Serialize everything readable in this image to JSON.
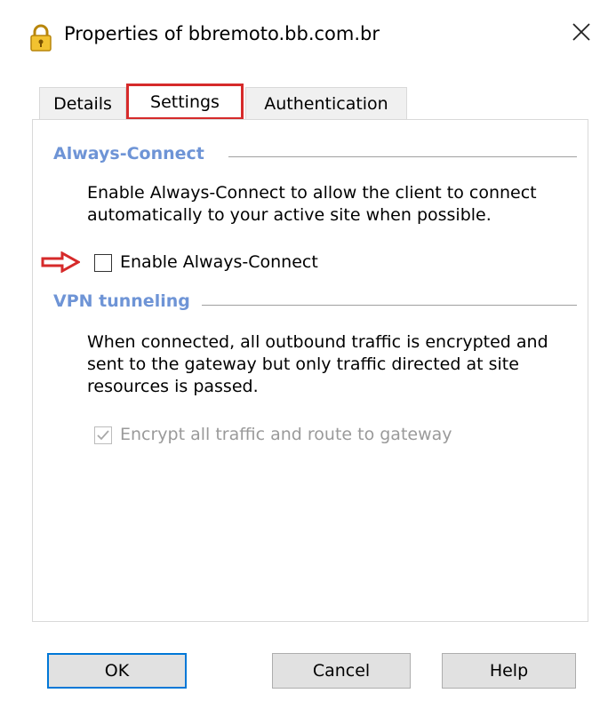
{
  "window": {
    "title": "Properties of bbremoto.bb.com.br",
    "close_symbol": "✕"
  },
  "tabs": [
    {
      "label": "Details"
    },
    {
      "label": "Settings"
    },
    {
      "label": "Authentication"
    }
  ],
  "always_connect": {
    "heading": "Always-Connect",
    "description_line1": "Enable Always-Connect to allow the client to connect",
    "description_line2": "automatically to your active site when possible.",
    "checkbox_label": "Enable Always-Connect",
    "checked": false
  },
  "vpn_tunneling": {
    "heading": "VPN tunneling",
    "description_line1": "When connected, all outbound traffic is encrypted and",
    "description_line2": "sent to the gateway but only traffic directed at site",
    "description_line3": "resources is passed.",
    "checkbox_label": "Encrypt all traffic and route to gateway",
    "checked": true,
    "disabled": true
  },
  "buttons": {
    "ok": "OK",
    "cancel": "Cancel",
    "help": "Help"
  },
  "colors": {
    "section_heading": "#6e94d6",
    "highlight": "#d62a2a",
    "focus": "#0078d7"
  },
  "icons": {
    "title": "lock-icon",
    "close": "close-icon",
    "annotation": "arrow-right-icon",
    "check": "checkmark-icon"
  }
}
